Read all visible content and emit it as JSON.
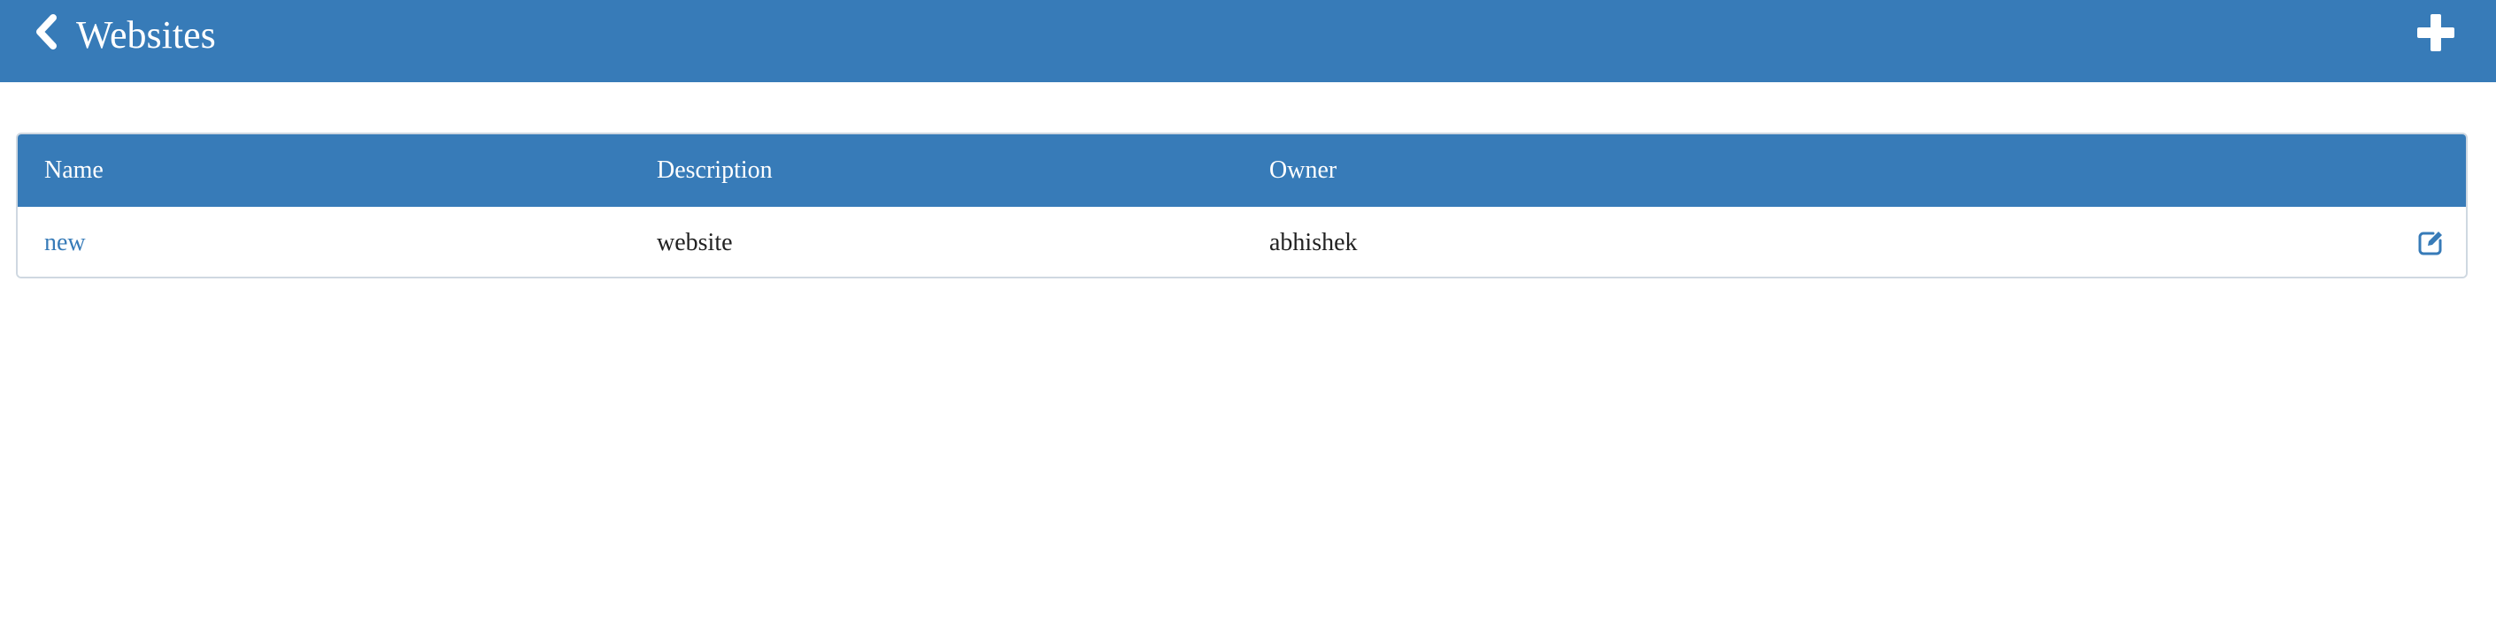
{
  "header": {
    "title": "Websites",
    "back_icon": "chevron-left-icon",
    "add_icon": "plus-icon",
    "background_color": "#377bb8"
  },
  "table": {
    "columns": [
      "Name",
      "Description",
      "Owner"
    ],
    "rows": [
      {
        "name": "new",
        "description": "website",
        "owner": "abhishek",
        "action_icon": "edit-icon"
      }
    ],
    "header_color": "#377bb8",
    "link_color": "#377bb8"
  }
}
